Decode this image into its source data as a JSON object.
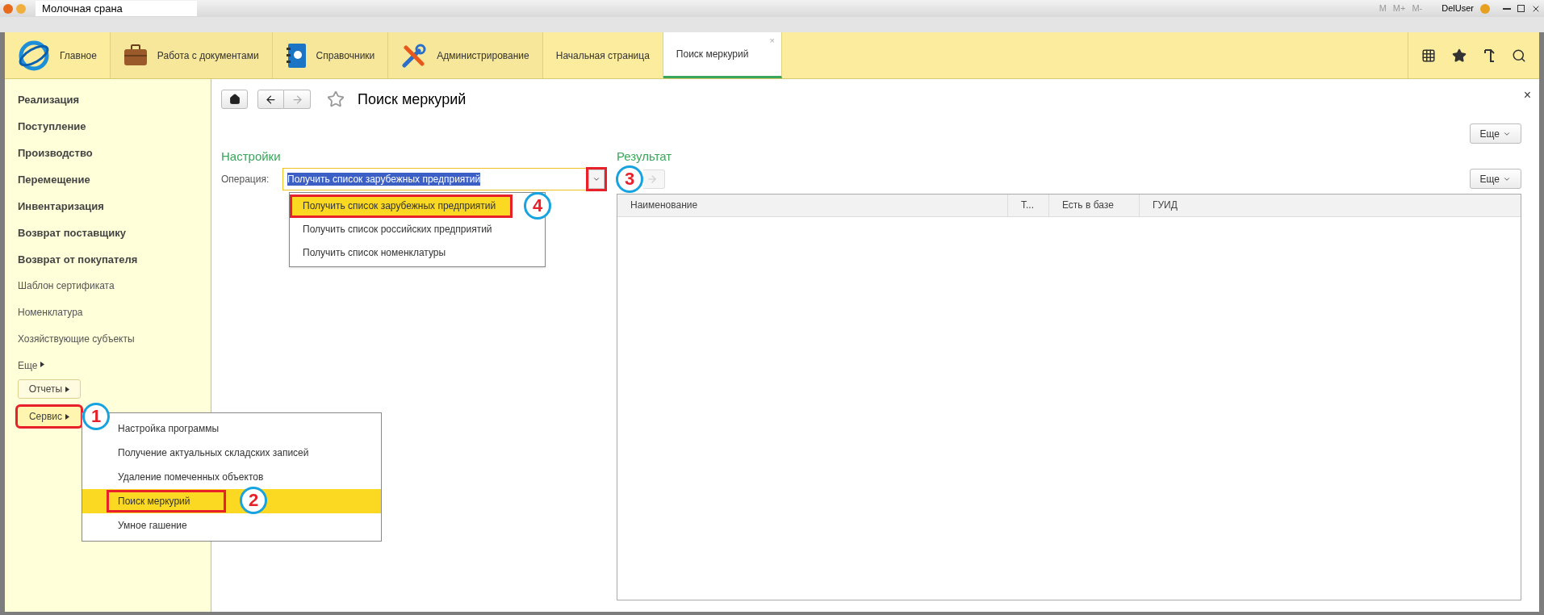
{
  "window": {
    "title": "Молочная срана",
    "marks": [
      "M",
      "M+",
      "M-"
    ],
    "user": "DelUser"
  },
  "sections": [
    {
      "label": "Главное",
      "kind": "logo"
    },
    {
      "label": "Работа с документами",
      "kind": "briefcase"
    },
    {
      "label": "Справочники",
      "kind": "book"
    },
    {
      "label": "Администрирование",
      "kind": "tools"
    }
  ],
  "open_tabs": [
    {
      "label": "Начальная страница",
      "selected": false
    },
    {
      "label": "Поиск меркурий",
      "selected": true,
      "close": "×"
    }
  ],
  "sidebar": {
    "items": [
      {
        "label": "Реализация",
        "kind": "bold"
      },
      {
        "label": "Поступление",
        "kind": "bold"
      },
      {
        "label": "Производство",
        "kind": "bold"
      },
      {
        "label": "Перемещение",
        "kind": "bold"
      },
      {
        "label": "Инвентаризация",
        "kind": "bold"
      },
      {
        "label": "Возврат поставщику",
        "kind": "bold"
      },
      {
        "label": "Возврат от покупателя",
        "kind": "bold"
      },
      {
        "label": "Шаблон сертификата",
        "kind": "plain"
      },
      {
        "label": "Номенклатура",
        "kind": "plain"
      },
      {
        "label": "Хозяйствующие субъекты",
        "kind": "plain"
      }
    ],
    "more": "Еще",
    "buttons": [
      {
        "label": "Отчеты",
        "open": false,
        "marked": false
      },
      {
        "label": "Сервис",
        "open": true,
        "marked": true,
        "callout": "1"
      }
    ]
  },
  "service_menu": {
    "items": [
      {
        "label": "Настройка программы",
        "selected": false,
        "marked": false
      },
      {
        "label": "Получение актуальных складских записей",
        "selected": false,
        "marked": false
      },
      {
        "label": "Удаление помеченных объектов",
        "selected": false,
        "marked": false
      },
      {
        "label": "Поиск меркурий",
        "selected": true,
        "marked": true,
        "callout": "2"
      },
      {
        "label": "Умное гашение",
        "selected": false,
        "marked": false
      }
    ]
  },
  "page": {
    "title": "Поиск меркурий",
    "close": "×",
    "more": "Еще",
    "settings": {
      "heading": "Настройки",
      "operation_label": "Операция:",
      "operation_value": "Получить список зарубежных предприятий",
      "dropdown_marked": true,
      "dropdown": [
        {
          "label": "Получить список зарубежных предприятий",
          "selected": true,
          "marked": true,
          "callout": "4"
        },
        {
          "label": "Получить список российских предприятий",
          "selected": false,
          "marked": false
        },
        {
          "label": "Получить список номенклатуры",
          "selected": false,
          "marked": false
        }
      ]
    },
    "result": {
      "heading": "Результат",
      "command_disabled": true,
      "callout": "3",
      "more": "Еще",
      "columns": [
        "Наименование",
        "Т...",
        "Есть в базе",
        "ГУИД"
      ]
    }
  }
}
